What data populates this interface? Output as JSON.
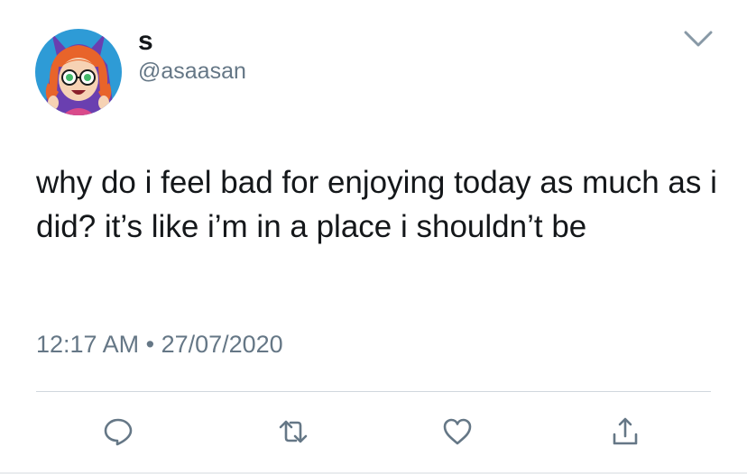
{
  "tweet": {
    "display_name": "s",
    "handle": "@asaasan",
    "text": "why do i feel bad for enjoying today as much as i did? it’s like i’m in a place i shouldn’t be",
    "time": "12:17 AM",
    "separator": "•",
    "date": "27/07/2020"
  },
  "icons": {
    "avatar": "cartoon-girl-avatar",
    "more": "chevron-down-icon",
    "reply": "reply-icon",
    "retweet": "retweet-icon",
    "like": "heart-icon",
    "share": "share-icon"
  },
  "colors": {
    "text": "#14171a",
    "secondary": "#657786",
    "avatar_bg": "#2e9bd6",
    "hair": "#e8642a",
    "hood": "#6a3fb0"
  }
}
